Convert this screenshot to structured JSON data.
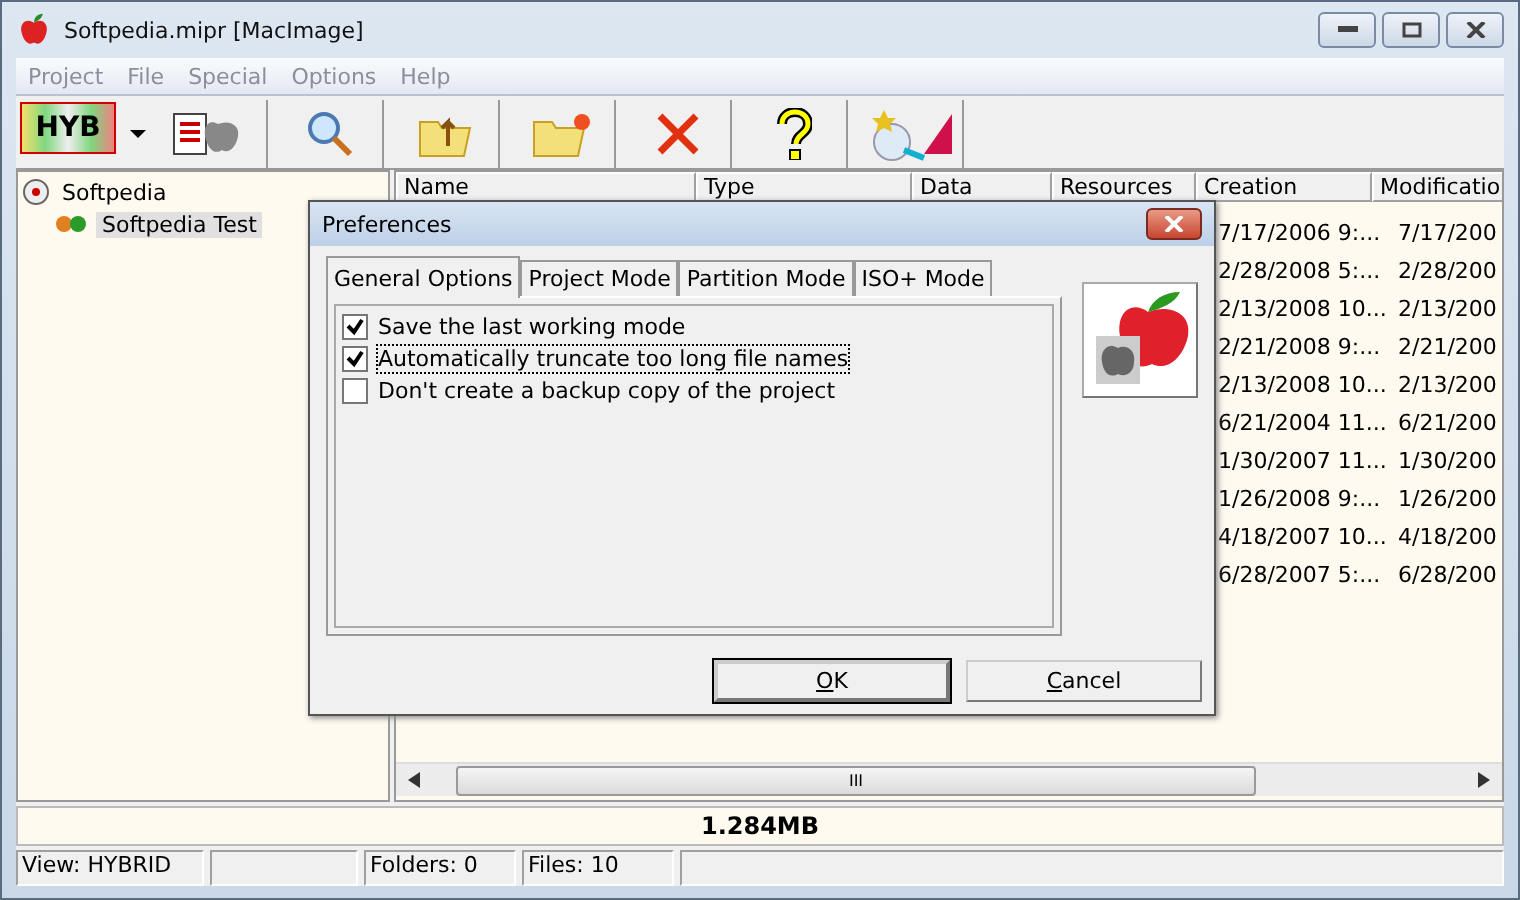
{
  "window": {
    "title": "Softpedia.mipr [MacImage]"
  },
  "menu": [
    "Project",
    "File",
    "Special",
    "Options",
    "Help"
  ],
  "toolbar": {
    "mode_label": "HYB"
  },
  "tree": [
    {
      "label": "Softpedia",
      "selected": false,
      "children": [
        {
          "label": "Softpedia Test",
          "selected": true
        }
      ]
    }
  ],
  "table": {
    "columns": [
      "Name",
      "Type",
      "Data",
      "Resources",
      "Creation",
      "Modificatio"
    ],
    "rows": [
      {
        "creation": "7/17/2006 9:...",
        "modification": "7/17/200"
      },
      {
        "creation": "2/28/2008 5:...",
        "modification": "2/28/200"
      },
      {
        "creation": "2/13/2008 10...",
        "modification": "2/13/200"
      },
      {
        "creation": "2/21/2008 9:...",
        "modification": "2/21/200"
      },
      {
        "creation": "2/13/2008 10...",
        "modification": "2/13/200"
      },
      {
        "creation": "6/21/2004 11...",
        "modification": "6/21/200"
      },
      {
        "creation": "1/30/2007 11...",
        "modification": "1/30/200"
      },
      {
        "creation": "1/26/2008 9:...",
        "modification": "1/26/200"
      },
      {
        "creation": "4/18/2007 10...",
        "modification": "4/18/200"
      },
      {
        "creation": "6/28/2007 5:...",
        "modification": "6/28/200"
      }
    ]
  },
  "scrollbar_grip": "III",
  "total_size": "1.284MB",
  "status_bar": {
    "view": "View: HYBRID",
    "folders": "Folders: 0",
    "files": "Files: 10"
  },
  "dialog": {
    "title": "Preferences",
    "tabs": [
      {
        "label": "General Options",
        "selected": true
      },
      {
        "label": "Project Mode",
        "selected": false
      },
      {
        "label": "Partition Mode",
        "selected": false
      },
      {
        "label": "ISO+ Mode",
        "selected": false
      }
    ],
    "options": [
      {
        "label": "Save the last working mode",
        "checked": true,
        "focused": false
      },
      {
        "label": "Automatically truncate too long file names",
        "checked": true,
        "focused": true
      },
      {
        "label": "Don't create a backup copy of the project",
        "checked": false,
        "focused": false
      }
    ],
    "buttons": [
      {
        "label": "OK",
        "default": true
      },
      {
        "label": "Cancel",
        "default": false
      }
    ]
  }
}
